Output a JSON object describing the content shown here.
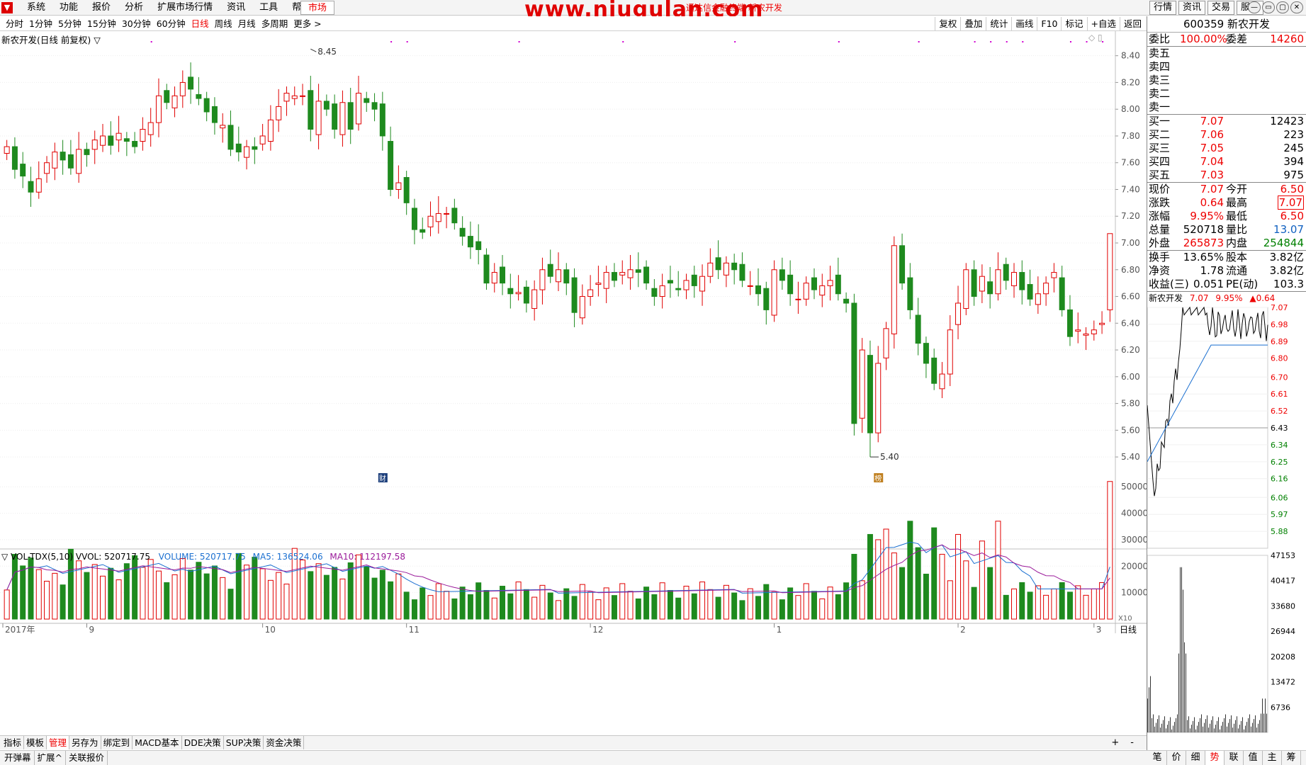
{
  "menubar": {
    "logo": "▼",
    "items": [
      "系统",
      "功能",
      "报价",
      "分析",
      "扩展市场行情",
      "资讯",
      "工具",
      "帮助"
    ],
    "market_tab": "市场",
    "watermark": "www.niugulan.com",
    "window_title": "通达信金融终端 新农开发",
    "right_tabs": [
      "行情",
      "资讯",
      "交易",
      "服务"
    ],
    "window_buttons": [
      "—",
      "▭",
      "▢",
      "✕"
    ]
  },
  "period_bar": {
    "periods": [
      "分时",
      "1分钟",
      "5分钟",
      "15分钟",
      "30分钟",
      "60分钟",
      "日线",
      "周线",
      "月线",
      "多周期",
      "更多 >"
    ],
    "active": "日线",
    "tools": [
      "复权",
      "叠加",
      "统计",
      "画线",
      "F10",
      "标记",
      "+自选",
      "返回"
    ]
  },
  "chart": {
    "title": "新农开发(日线 前复权) ▽",
    "corner": "◇ ▯",
    "high_label": "8.45",
    "low_label": "5.40",
    "marker_1": "财",
    "marker_2": "榜",
    "x_labels": [
      "2017年",
      "9",
      "10",
      "11",
      "12",
      "1",
      "2",
      "3"
    ],
    "price_ticks": [
      "8.40",
      "8.20",
      "8.00",
      "7.80",
      "7.60",
      "7.40",
      "7.20",
      "7.00",
      "6.80",
      "6.60",
      "6.40",
      "6.20",
      "6.00",
      "5.80",
      "5.60",
      "5.40"
    ],
    "vol_ticks": [
      "50000",
      "40000",
      "30000",
      "20000",
      "10000"
    ],
    "vol_unit": "X10",
    "period_label": "日线",
    "vol_legend": {
      "main": "▽ VOL-TDX(5,10)  VVOL: 520717.75",
      "volume": "VOLUME: 520717.75",
      "ma5": "MA5: 136524.06",
      "ma10": "MA10: 112197.58"
    }
  },
  "chart_data": {
    "type": "candlestick",
    "price_range": [
      5.3,
      8.52
    ],
    "volume_range": [
      0,
      53000
    ],
    "high": 8.45,
    "low": 5.4,
    "last_volume": 520717.75,
    "ma5": 136524.06,
    "ma10": 112197.58,
    "colors": {
      "up": "#e00000",
      "down": "#1e8a1e",
      "ma5": "#1a6fd0",
      "ma10": "#9a1a9a"
    }
  },
  "bottom_bar": {
    "items": [
      "指标",
      "模板",
      "管理",
      "另存为",
      "绑定到",
      "MACD基本",
      "DDE决策",
      "SUP决策",
      "资金决策"
    ],
    "active": "管理",
    "right": [
      "+",
      "-"
    ]
  },
  "status_bar": {
    "items": [
      "开弹幕",
      "扩展^",
      "关联报价"
    ],
    "right_tabs": [
      "笔",
      "价",
      "细",
      "势",
      "联",
      "值",
      "主",
      "筹"
    ],
    "active": "势"
  },
  "quote": {
    "code": "600359",
    "name": "新农开发",
    "weibi_label": "委比",
    "weibi": "100.00%",
    "weicha_label": "委差",
    "weicha": "14260",
    "sells": [
      {
        "label": "卖五",
        "price": "",
        "vol": ""
      },
      {
        "label": "卖四",
        "price": "",
        "vol": ""
      },
      {
        "label": "卖三",
        "price": "",
        "vol": ""
      },
      {
        "label": "卖二",
        "price": "",
        "vol": ""
      },
      {
        "label": "卖一",
        "price": "",
        "vol": ""
      }
    ],
    "buys": [
      {
        "label": "买一",
        "price": "7.07",
        "vol": "12423"
      },
      {
        "label": "买二",
        "price": "7.06",
        "vol": "223"
      },
      {
        "label": "买三",
        "price": "7.05",
        "vol": "245"
      },
      {
        "label": "买四",
        "price": "7.04",
        "vol": "394"
      },
      {
        "label": "买五",
        "price": "7.03",
        "vol": "975"
      }
    ],
    "stats1": [
      {
        "l1": "现价",
        "v1": "7.07",
        "l2": "今开",
        "v2": "6.50"
      },
      {
        "l1": "涨跌",
        "v1": "0.64",
        "l2": "最高",
        "v2": "7.07"
      },
      {
        "l1": "涨幅",
        "v1": "9.95%",
        "l2": "最低",
        "v2": "6.50"
      },
      {
        "l1": "总量",
        "v1": "520718",
        "l2": "量比",
        "v2": "13.07"
      },
      {
        "l1": "外盘",
        "v1": "265873",
        "l2": "内盘",
        "v2": "254844"
      }
    ],
    "stats2": [
      {
        "l1": "换手",
        "v1": "13.65%",
        "l2": "股本",
        "v2": "3.82亿"
      },
      {
        "l1": "净资",
        "v1": "1.78",
        "l2": "流通",
        "v2": "3.82亿"
      },
      {
        "l1": "收益(三)",
        "v1": "0.051",
        "l2": "PE(动)",
        "v2": "103.3"
      }
    ]
  },
  "mini_chart": {
    "name": "新农开发",
    "price": "7.07",
    "pct": "9.95%",
    "chg": "▲0.64",
    "price_ticks": [
      "7.07",
      "6.98",
      "6.89",
      "6.80",
      "6.70",
      "6.61",
      "6.52",
      "6.43",
      "6.34",
      "6.25",
      "6.16",
      "6.06",
      "5.97",
      "5.88"
    ],
    "vol_ticks": [
      "47153",
      "40417",
      "33680",
      "26944",
      "20208",
      "13472",
      "6736"
    ],
    "prev_close": 6.43,
    "price_range": [
      5.79,
      7.07
    ]
  }
}
